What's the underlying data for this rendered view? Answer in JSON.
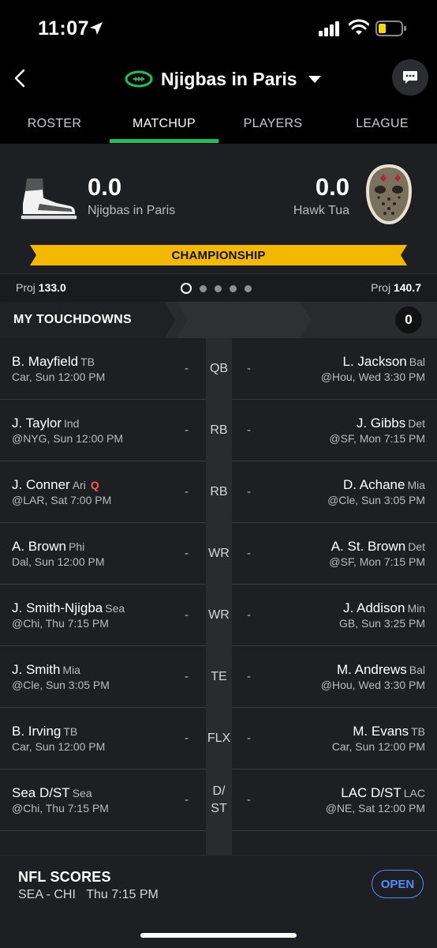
{
  "status_bar": {
    "time": "11:07"
  },
  "header": {
    "title": "Njigbas in Paris"
  },
  "tabs": [
    {
      "label": "ROSTER"
    },
    {
      "label": "MATCHUP"
    },
    {
      "label": "PLAYERS"
    },
    {
      "label": "LEAGUE"
    }
  ],
  "matchup": {
    "left": {
      "score": "0.0",
      "team": "Njigbas in Paris",
      "proj_label": "Proj",
      "proj": "133.0"
    },
    "right": {
      "score": "0.0",
      "team": "Hawk Tua",
      "proj_label": "Proj",
      "proj": "140.7"
    },
    "banner": "CHAMPIONSHIP",
    "banner_color": "#f5b800",
    "page_dots": 5,
    "active_dot": 0
  },
  "touchdowns": {
    "label": "MY TOUCHDOWNS",
    "count": "0"
  },
  "rows": [
    {
      "pos": "QB",
      "l_name": "B. Mayfield",
      "l_team": "TB",
      "l_flag": "",
      "l_sub": "Car, Sun 12:00 PM",
      "l_pts": "-",
      "r_pts": "-",
      "r_name": "L. Jackson",
      "r_team": "Bal",
      "r_sub": "@Hou, Wed 3:30 PM"
    },
    {
      "pos": "RB",
      "l_name": "J. Taylor",
      "l_team": "Ind",
      "l_flag": "",
      "l_sub": "@NYG, Sun 12:00 PM",
      "l_pts": "-",
      "r_pts": "-",
      "r_name": "J. Gibbs",
      "r_team": "Det",
      "r_sub": "@SF, Mon 7:15 PM"
    },
    {
      "pos": "RB",
      "l_name": "J. Conner",
      "l_team": "Ari",
      "l_flag": "Q",
      "l_sub": "@LAR, Sat 7:00 PM",
      "l_pts": "-",
      "r_pts": "-",
      "r_name": "D. Achane",
      "r_team": "Mia",
      "r_sub": "@Cle, Sun 3:05 PM"
    },
    {
      "pos": "WR",
      "l_name": "A. Brown",
      "l_team": "Phi",
      "l_flag": "",
      "l_sub": "Dal, Sun 12:00 PM",
      "l_pts": "-",
      "r_pts": "-",
      "r_name": "A. St. Brown",
      "r_team": "Det",
      "r_sub": "@SF, Mon 7:15 PM"
    },
    {
      "pos": "WR",
      "l_name": "J. Smith-Njigba",
      "l_team": "Sea",
      "l_flag": "",
      "l_sub": "@Chi, Thu 7:15 PM",
      "l_pts": "-",
      "r_pts": "-",
      "r_name": "J. Addison",
      "r_team": "Min",
      "r_sub": "GB, Sun 3:25 PM"
    },
    {
      "pos": "TE",
      "l_name": "J. Smith",
      "l_team": "Mia",
      "l_flag": "",
      "l_sub": "@Cle, Sun 3:05 PM",
      "l_pts": "-",
      "r_pts": "-",
      "r_name": "M. Andrews",
      "r_team": "Bal",
      "r_sub": "@Hou, Wed 3:30 PM"
    },
    {
      "pos": "FLX",
      "l_name": "B. Irving",
      "l_team": "TB",
      "l_flag": "",
      "l_sub": "Car, Sun 12:00 PM",
      "l_pts": "-",
      "r_pts": "-",
      "r_name": "M. Evans",
      "r_team": "TB",
      "r_sub": "Car, Sun 12:00 PM"
    },
    {
      "pos": "D/ST",
      "l_name": "Sea D/ST",
      "l_team": "Sea",
      "l_flag": "",
      "l_sub": "@Chi, Thu 7:15 PM",
      "l_pts": "-",
      "r_pts": "-",
      "r_name": "LAC D/ST",
      "r_team": "LAC",
      "r_sub": "@NE, Sat 12:00 PM"
    }
  ],
  "scores": {
    "title": "NFL SCORES",
    "game": "SEA - CHI",
    "game_time": "Thu 7:15 PM",
    "open_label": "OPEN"
  },
  "colors": {
    "accent_green": "#1ec25a",
    "open_blue": "#4f8cff",
    "injury_red": "#ff5555"
  }
}
